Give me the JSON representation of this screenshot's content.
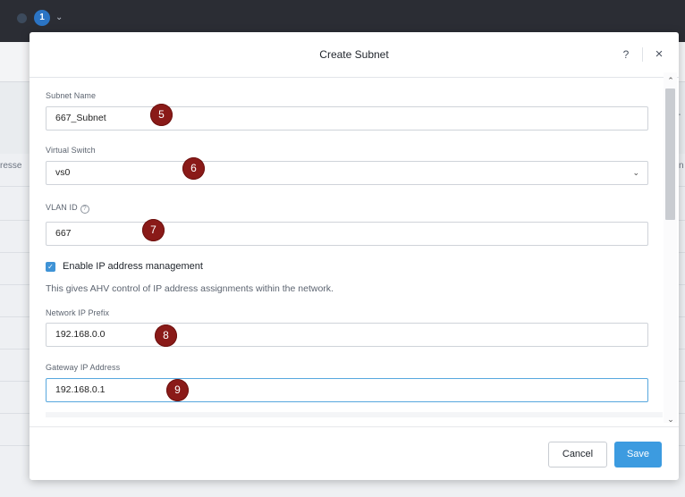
{
  "background": {
    "notification_count": "1",
    "partial_column_left": "resse",
    "partial_column_right": "n",
    "partial_header_right": "-"
  },
  "dialog": {
    "title": "Create Subnet",
    "help_label": "?",
    "close_label": "×"
  },
  "form": {
    "subnet_name": {
      "label": "Subnet Name",
      "value": "667_Subnet"
    },
    "virtual_switch": {
      "label": "Virtual Switch",
      "value": "vs0"
    },
    "vlan_id": {
      "label": "VLAN ID",
      "value": "667"
    },
    "ip_management": {
      "label": "Enable IP address management",
      "checked": true,
      "description": "This gives AHV control of IP address assignments within the network."
    },
    "network_ip_prefix": {
      "label": "Network IP Prefix",
      "value": "192.168.0.0"
    },
    "gateway_ip": {
      "label": "Gateway IP Address",
      "value": "192.168.0.1"
    }
  },
  "markers": [
    "5",
    "6",
    "7",
    "8",
    "9"
  ],
  "footer": {
    "cancel_label": "Cancel",
    "save_label": "Save"
  },
  "icons": {
    "help": "question-circle-icon",
    "close": "close-icon",
    "select": "chevron-down-icon",
    "checkbox": "checkmark-icon"
  },
  "colors": {
    "topbar": "#2b2d34",
    "primary": "#3c9be0",
    "marker": "#8a1a18",
    "focus_border": "#57a7de"
  }
}
